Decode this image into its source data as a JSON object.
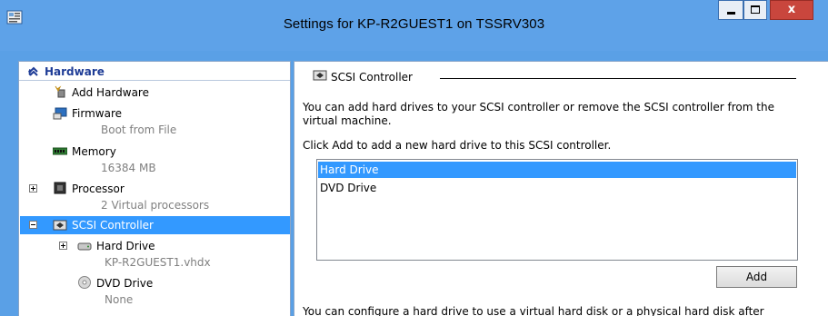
{
  "window": {
    "title": "Settings for KP-R2GUEST1 on TSSRV303",
    "minimize_glyph": "",
    "close_glyph": "x"
  },
  "tree": {
    "group_label": "Hardware",
    "items": {
      "add_hardware": {
        "label": "Add Hardware"
      },
      "firmware": {
        "label": "Firmware",
        "sub": "Boot from File"
      },
      "memory": {
        "label": "Memory",
        "sub": "16384 MB"
      },
      "processor": {
        "label": "Processor",
        "sub": "2 Virtual processors"
      },
      "scsi": {
        "label": "SCSI Controller"
      },
      "hard_drive": {
        "label": "Hard Drive",
        "sub": "KP-R2GUEST1.vhdx"
      },
      "dvd_drive": {
        "label": "DVD Drive",
        "sub": "None"
      }
    }
  },
  "details": {
    "section_title": "SCSI Controller",
    "description": "You can add hard drives to your SCSI controller or remove the SCSI controller from the virtual machine.",
    "instruction": "Click Add to add a new hard drive to this SCSI controller.",
    "drive_types": [
      "Hard Drive",
      "DVD Drive"
    ],
    "selected_drive_type": "Hard Drive",
    "add_button": "Add",
    "footer_text": "You can configure a hard drive to use a virtual hard disk or a physical hard disk after"
  },
  "colors": {
    "selection": "#3399ff",
    "titlebar": "#5ea2e8",
    "group_header": "#1e3c96",
    "close_button": "#c9463d"
  }
}
